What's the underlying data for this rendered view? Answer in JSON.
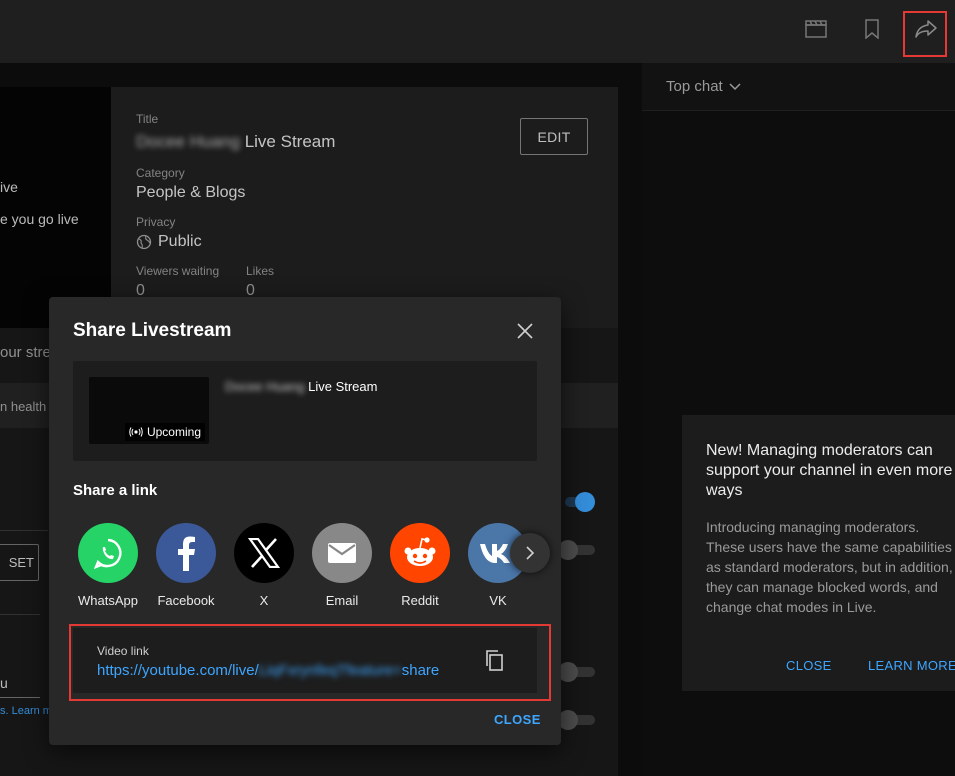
{
  "topbar": {
    "icons": [
      "clapperboard-icon",
      "bookmark-icon",
      "share-icon"
    ]
  },
  "left_preview": {
    "line1": "ive",
    "line2": "e you go live"
  },
  "details": {
    "title_label": "Title",
    "title_blurred": "Docee Huang",
    "title_suffix": " Live Stream",
    "edit_label": "EDIT",
    "category_label": "Category",
    "category_value": "People & Blogs",
    "privacy_label": "Privacy",
    "privacy_value": "Public",
    "viewers_label": "Viewers waiting",
    "viewers_value": "0",
    "likes_label": "Likes",
    "likes_value": "0"
  },
  "left_lower": {
    "stream_text": "our stre",
    "health_text": "n health",
    "reset_label": "SET",
    "input_fragment": "u",
    "learn_text": "s. Learn m"
  },
  "chat": {
    "mode_label": "Top chat"
  },
  "promo": {
    "title": "New! Managing moderators can support your channel in even more ways",
    "body": "Introducing managing moderators. These users have the same capabilities as standard moderators, but in addition, they can manage blocked words, and change chat modes in Live.",
    "close_label": "CLOSE",
    "learn_more_label": "LEARN MORE"
  },
  "modal": {
    "title": "Share Livestream",
    "card_title_blurred": "Docee Huang",
    "card_title_suffix": " Live Stream",
    "badge_label": "Upcoming",
    "share_link_label": "Share a link",
    "sites": [
      {
        "label": "WhatsApp",
        "color": "#25d366",
        "icon": "whatsapp-icon"
      },
      {
        "label": "Facebook",
        "color": "#3b5998",
        "icon": "facebook-icon"
      },
      {
        "label": "X",
        "color": "#000000",
        "icon": "x-icon"
      },
      {
        "label": "Email",
        "color": "#888888",
        "icon": "email-icon"
      },
      {
        "label": "Reddit",
        "color": "#ff4500",
        "icon": "reddit-icon"
      },
      {
        "label": "VK",
        "color": "#4a76a8",
        "icon": "vk-icon"
      }
    ],
    "video_link_label": "Video link",
    "video_link_prefix": "https://youtube.com/live/",
    "video_link_blurred": "LiqFxrynfeqTfeature=",
    "video_link_suffix": "share",
    "close_label": "CLOSE"
  }
}
